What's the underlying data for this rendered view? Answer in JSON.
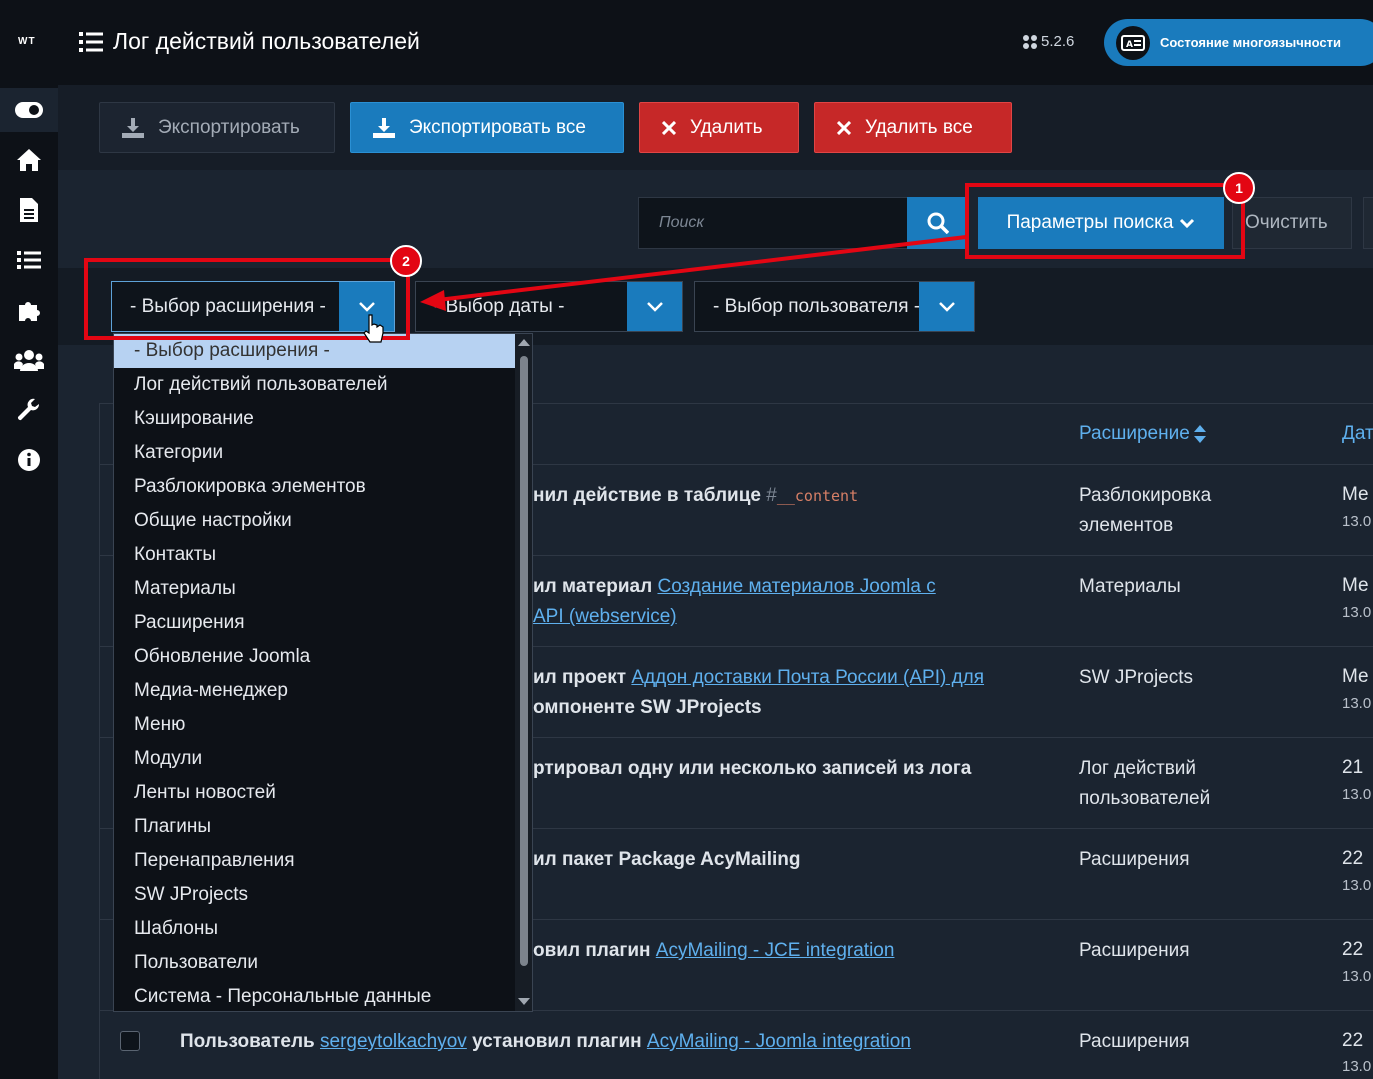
{
  "header": {
    "logo": "WT",
    "title": "Лог действий пользователей",
    "version": "5.2.6",
    "multilang_label": "Состояние многоязычности"
  },
  "sidebar": {
    "items": [
      {
        "icon": "toggle-icon"
      },
      {
        "icon": "home-icon"
      },
      {
        "icon": "document-icon"
      },
      {
        "icon": "list-icon"
      },
      {
        "icon": "puzzle-icon"
      },
      {
        "icon": "users-icon"
      },
      {
        "icon": "wrench-icon"
      },
      {
        "icon": "info-icon"
      }
    ]
  },
  "toolbar": {
    "export_label": "Экспортировать",
    "export_all_label": "Экспортировать все",
    "delete_label": "Удалить",
    "delete_all_label": "Удалить все"
  },
  "search": {
    "placeholder": "Поиск",
    "params_label": "Параметры поиска",
    "clear_label": "Очистить"
  },
  "filters": {
    "extension": "- Выбор расширения -",
    "date": "- Выбор даты -",
    "user": "- Выбор пользователя -"
  },
  "dropdown": {
    "options": [
      "- Выбор расширения -",
      "Лог действий пользователей",
      "Кэширование",
      "Категории",
      "Разблокировка элементов",
      "Общие настройки",
      "Контакты",
      "Материалы",
      "Расширения",
      "Обновление Joomla",
      "Медиа-менеджер",
      "Меню",
      "Модули",
      "Ленты новостей",
      "Плагины",
      "Перенаправления",
      "SW JProjects",
      "Шаблоны",
      "Пользователи",
      "Система - Персональные данные"
    ]
  },
  "table": {
    "col_extension": "Расширение",
    "col_date": "Дат",
    "rows": [
      {
        "action": "нил действие в таблице ",
        "hash": "#",
        "code": "__content",
        "ext": "Разблокировка элементов",
        "date1": "Ме",
        "date2": "13.0"
      },
      {
        "action": "ил материал ",
        "link": "Создание материалов Joomla с",
        "action2": "",
        "link2": "API (webservice)",
        "ext": "Материалы",
        "date1": "Ме",
        "date2": "13.0"
      },
      {
        "action": "ил проект ",
        "link": "Аддон доставки Почта России (API) для",
        "action2": "омпоненте SW JProjects",
        "ext": "SW JProjects",
        "date1": "Ме",
        "date2": "13.0"
      },
      {
        "action": "ртировал одну или несколько записей из лога",
        "ext": "Лог действий пользователей",
        "date1": "21 ",
        "date2": "13.0"
      },
      {
        "action": "ил пакет Package AcyMailing",
        "ext": "Расширения",
        "date1": "22 ",
        "date2": "13.0"
      },
      {
        "action": "овил плагин ",
        "link": "AcyMailing - JCE integration",
        "ext": "Расширения",
        "date1": "22 ",
        "date2": "13.0"
      },
      {
        "action": "Пользователь ",
        "user": "sergeytolkachyov",
        "action2": " установил плагин ",
        "link": "AcyMailing - Joomla integration",
        "ext": "Расширения",
        "date1": "22 ",
        "date2": "13.0"
      }
    ]
  },
  "annotations": {
    "badge1": "1",
    "badge2": "2"
  },
  "colors": {
    "accent": "#1a7bbd",
    "danger": "#c62828",
    "annotation": "#e30613"
  }
}
